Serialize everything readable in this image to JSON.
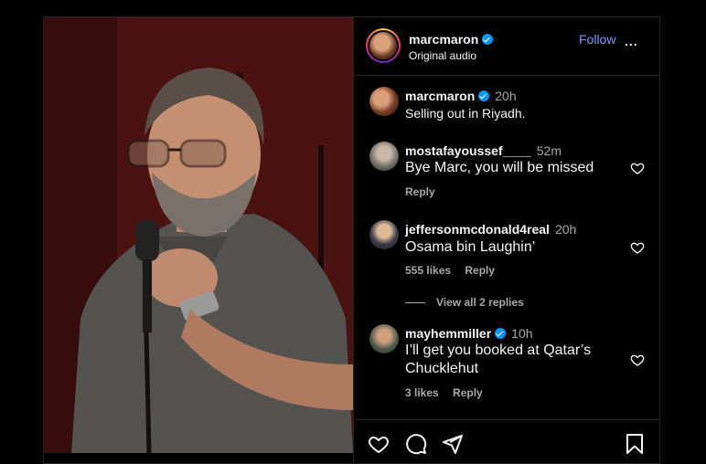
{
  "header": {
    "username": "marcmaron",
    "subtitle": "Original audio",
    "follow_label": "Follow",
    "more_label": "..."
  },
  "caption": {
    "username": "marcmaron",
    "time": "20h",
    "text": "Selling out in Riyadh."
  },
  "comments": [
    {
      "username": "mostafayoussef____",
      "time": "52m",
      "text": "Bye Marc, you will be missed",
      "likes": "",
      "reply_label": "Reply",
      "verified": false
    },
    {
      "username": "jeffersonmcdonald4real",
      "time": "20h",
      "text": "Osama bin Laughin’",
      "likes": "555 likes",
      "reply_label": "Reply",
      "view_replies": "View all 2 replies",
      "verified": false
    },
    {
      "username": "mayhemmiller",
      "time": "10h",
      "text_line1": "I’ll get you booked at Qatar’s",
      "text_line2": "Chucklehut",
      "likes": "3 likes",
      "reply_label": "Reply",
      "verified": true
    }
  ],
  "colors": {
    "accent_link": "#7f9bff",
    "verified": "#0095f6",
    "border": "#262626",
    "muted_text": "#a8a8a8"
  },
  "icons": [
    "verified-icon",
    "more-icon",
    "heart-icon",
    "comment-icon",
    "share-icon",
    "bookmark-icon"
  ]
}
